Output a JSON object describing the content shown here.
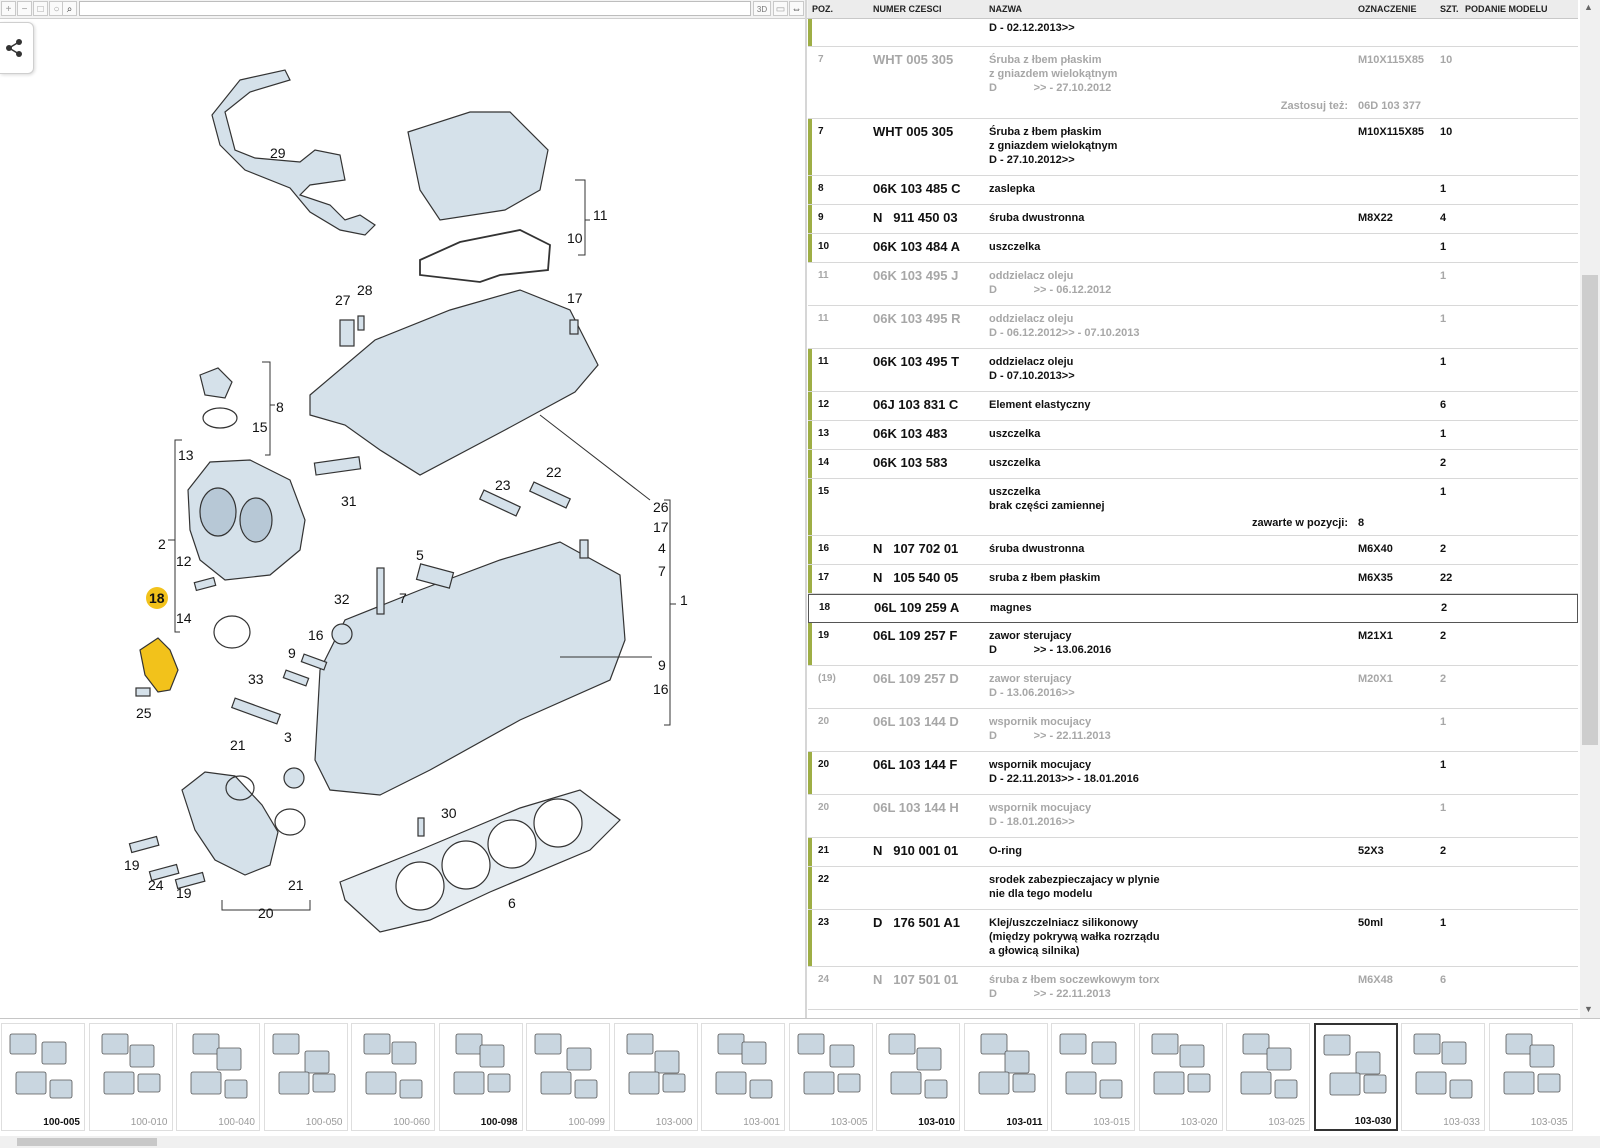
{
  "toolbar": {
    "search_value": "",
    "btn_3d": "3D"
  },
  "diagram": {
    "labels": [
      "29",
      "11",
      "10",
      "27",
      "28",
      "17",
      "8",
      "15",
      "13",
      "31",
      "26",
      "17",
      "4",
      "7",
      "2",
      "12",
      "23",
      "22",
      "5",
      "18",
      "14",
      "32",
      "7",
      "1",
      "16",
      "9",
      "9",
      "33",
      "25",
      "16",
      "21",
      "3",
      "30",
      "21",
      "19",
      "24",
      "19",
      "20",
      "6"
    ],
    "highlight": "18"
  },
  "table": {
    "headers": {
      "pos": "POZ.",
      "num": "NUMER CZESCI",
      "name": "NAZWA",
      "ozn": "OZNACZENIE",
      "qty": "SZT.",
      "model": "PODANIE MODELU"
    },
    "rows": [
      {
        "pos": "",
        "num": "",
        "name": "D - 02.12.2013>>",
        "ozn": "",
        "qty": "",
        "dim": false,
        "bar": true
      },
      {
        "pos": "7",
        "num": "WHT 005 305",
        "name": "Śruba z łbem płaskim\nz gniazdem wielokątnym\nD            >> - 27.10.2012",
        "ozn": "M10X115X85",
        "qty": "10",
        "dim": true,
        "bar": false,
        "ref_label": "Zastosuj też:",
        "ref_value": "06D 103 377"
      },
      {
        "pos": "7",
        "num": "WHT 005 305",
        "name": "Śruba z łbem płaskim\nz gniazdem wielokątnym\nD - 27.10.2012>>",
        "ozn": "M10X115X85",
        "qty": "10",
        "dim": false,
        "bar": true
      },
      {
        "pos": "8",
        "num": "06K 103 485 C",
        "name": "zaslepka",
        "ozn": "",
        "qty": "1",
        "dim": false,
        "bar": true
      },
      {
        "pos": "9",
        "num": "N   911 450 03",
        "name": "śruba dwustronna",
        "ozn": "M8X22",
        "qty": "4",
        "dim": false,
        "bar": true
      },
      {
        "pos": "10",
        "num": "06K 103 484 A",
        "name": "uszczelka",
        "ozn": "",
        "qty": "1",
        "dim": false,
        "bar": true
      },
      {
        "pos": "11",
        "num": "06K 103 495 J",
        "name": "oddzielacz oleju\nD            >> - 06.12.2012",
        "ozn": "",
        "qty": "1",
        "dim": true,
        "bar": false
      },
      {
        "pos": "11",
        "num": "06K 103 495 R",
        "name": "oddzielacz oleju\nD - 06.12.2012>> - 07.10.2013",
        "ozn": "",
        "qty": "1",
        "dim": true,
        "bar": false
      },
      {
        "pos": "11",
        "num": "06K 103 495 T",
        "name": "oddzielacz oleju\nD - 07.10.2013>>",
        "ozn": "",
        "qty": "1",
        "dim": false,
        "bar": true
      },
      {
        "pos": "12",
        "num": "06J 103 831 C",
        "name": "Element elastyczny",
        "ozn": "",
        "qty": "6",
        "dim": false,
        "bar": true
      },
      {
        "pos": "13",
        "num": "06K 103 483",
        "name": "uszczelka",
        "ozn": "",
        "qty": "1",
        "dim": false,
        "bar": true
      },
      {
        "pos": "14",
        "num": "06K 103 583",
        "name": "uszczelka",
        "ozn": "",
        "qty": "2",
        "dim": false,
        "bar": true
      },
      {
        "pos": "15",
        "num": "",
        "name": "uszczelka\nbrak części zamiennej",
        "ozn": "",
        "qty": "1",
        "dim": false,
        "bar": true,
        "ref_label": "zawarte w pozycji:",
        "ref_value": "8"
      },
      {
        "pos": "16",
        "num": "N   107 702 01",
        "name": "śruba dwustronna",
        "ozn": "M6X40",
        "qty": "2",
        "dim": false,
        "bar": true
      },
      {
        "pos": "17",
        "num": "N   105 540 05",
        "name": "sruba z łbem płaskim",
        "ozn": "M6X35",
        "qty": "22",
        "dim": false,
        "bar": true
      },
      {
        "pos": "18",
        "num": "06L 109 259 A",
        "name": "magnes",
        "ozn": "",
        "qty": "2",
        "dim": false,
        "bar": false,
        "selected": true
      },
      {
        "pos": "19",
        "num": "06L 109 257 F",
        "name": "zawor sterujacy\nD            >> - 13.06.2016",
        "ozn": "M21X1",
        "qty": "2",
        "dim": false,
        "bar": true
      },
      {
        "pos": "(19)",
        "num": "06L 109 257 D",
        "name": "zawor sterujacy\nD - 13.06.2016>>",
        "ozn": "M20X1",
        "qty": "2",
        "dim": true,
        "bar": false
      },
      {
        "pos": "20",
        "num": "06L 103 144 D",
        "name": "wspornik mocujacy\nD            >> - 22.11.2013",
        "ozn": "",
        "qty": "1",
        "dim": true,
        "bar": false
      },
      {
        "pos": "20",
        "num": "06L 103 144 F",
        "name": "wspornik mocujacy\nD - 22.11.2013>> - 18.01.2016",
        "ozn": "",
        "qty": "1",
        "dim": false,
        "bar": true
      },
      {
        "pos": "20",
        "num": "06L 103 144 H",
        "name": "wspornik mocujacy\nD - 18.01.2016>>",
        "ozn": "",
        "qty": "1",
        "dim": true,
        "bar": false
      },
      {
        "pos": "21",
        "num": "N   910 001 01",
        "name": "O-ring",
        "ozn": "52X3",
        "qty": "2",
        "dim": false,
        "bar": true
      },
      {
        "pos": "22",
        "num": "",
        "name": "srodek zabezpieczajacy w plynie\nnie dla tego modelu",
        "ozn": "",
        "qty": "",
        "dim": false,
        "bar": true
      },
      {
        "pos": "23",
        "num": "D   176 501 A1",
        "name": "Klej/uszczelniacz silikonowy\n(między pokrywą wałka rozrządu\na głowicą silnika)",
        "ozn": "50ml",
        "qty": "1",
        "dim": false,
        "bar": true
      },
      {
        "pos": "24",
        "num": "N   107 501 01",
        "name": "śruba z łbem soczewkowym torx\nD            >> - 22.11.2013",
        "ozn": "M6X48",
        "qty": "6",
        "dim": true,
        "bar": false
      }
    ]
  },
  "thumbnails": [
    {
      "label": "100-005",
      "bold": true
    },
    {
      "label": "100-010",
      "bold": false
    },
    {
      "label": "100-040",
      "bold": false
    },
    {
      "label": "100-050",
      "bold": false
    },
    {
      "label": "100-060",
      "bold": false
    },
    {
      "label": "100-098",
      "bold": true
    },
    {
      "label": "100-099",
      "bold": false
    },
    {
      "label": "103-000",
      "bold": false
    },
    {
      "label": "103-001",
      "bold": false
    },
    {
      "label": "103-005",
      "bold": false
    },
    {
      "label": "103-010",
      "bold": true
    },
    {
      "label": "103-011",
      "bold": true
    },
    {
      "label": "103-015",
      "bold": false
    },
    {
      "label": "103-020",
      "bold": false
    },
    {
      "label": "103-025",
      "bold": false
    },
    {
      "label": "103-030",
      "bold": true,
      "selected": true
    },
    {
      "label": "103-033",
      "bold": false
    },
    {
      "label": "103-035",
      "bold": false
    }
  ],
  "colors": {
    "accent_bar": "#9eae45",
    "highlight": "#f2c21b"
  }
}
